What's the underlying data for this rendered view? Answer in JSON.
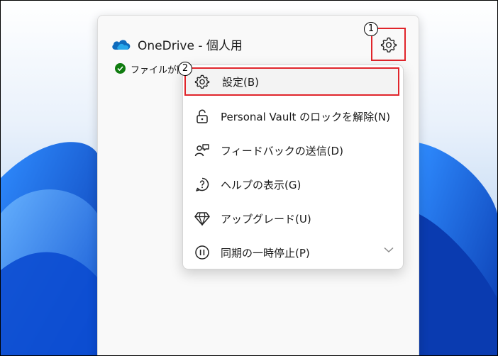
{
  "panel": {
    "title": "OneDrive - 個人用",
    "sync_status": "ファイルが同",
    "sync_status_tail": "……"
  },
  "badges": {
    "first": "1",
    "second": "2"
  },
  "menu": {
    "items": [
      {
        "label": "設定(B)",
        "icon": "gear-icon"
      },
      {
        "label": "Personal Vault のロックを解除(N)",
        "icon": "unlock-icon"
      },
      {
        "label": "フィードバックの送信(D)",
        "icon": "feedback-icon"
      },
      {
        "label": "ヘルプの表示(G)",
        "icon": "help-icon"
      },
      {
        "label": "アップグレード(U)",
        "icon": "diamond-icon"
      },
      {
        "label": "同期の一時停止(P)",
        "icon": "pause-icon"
      }
    ]
  },
  "colors": {
    "highlight": "#e0252b",
    "onedrive_blue": "#0f6cbd",
    "sync_green": "#107c10"
  }
}
